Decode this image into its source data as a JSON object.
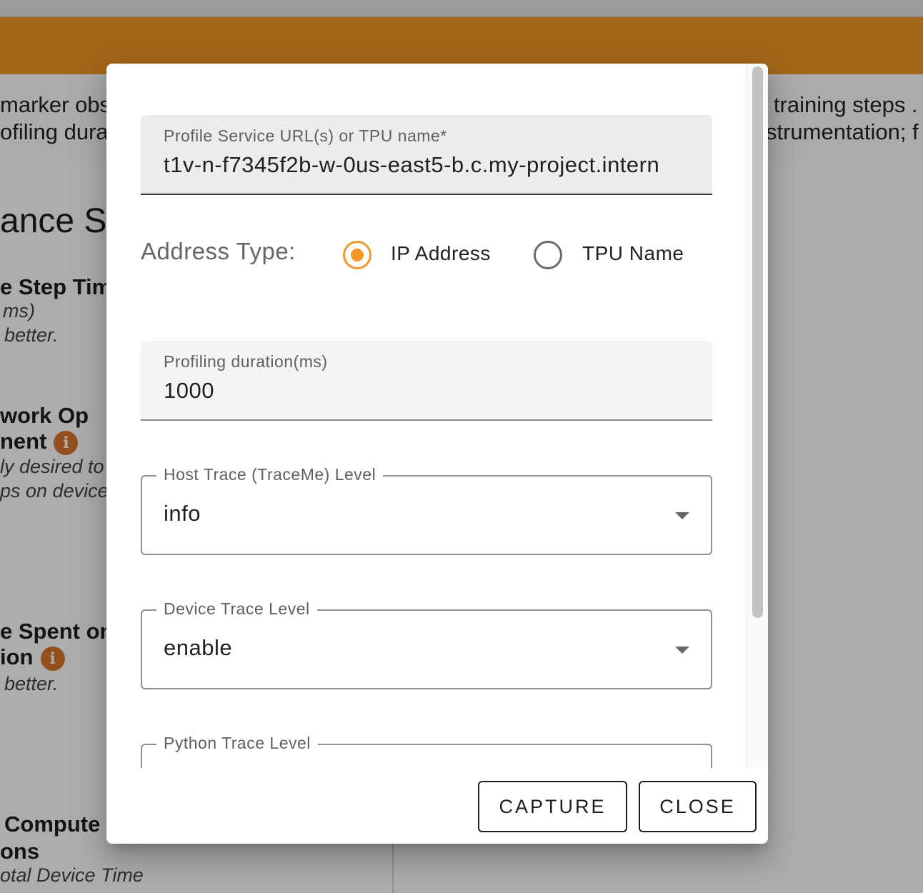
{
  "background": {
    "banner_line1_left": "marker obs",
    "banner_line2_left": "ofiling dura",
    "banner_line1_right": ") training steps .",
    "banner_line2_right": "strumentation; f",
    "section_title": "ance S",
    "card1_title": "e Step Tim",
    "card1_unit": "ms)",
    "card1_hint": "better.",
    "card2_title_line1": "work Op",
    "card2_title_line2": "nent",
    "card2_hint_line1": "ly desired to",
    "card2_hint_line2": "ps on device",
    "card3_title_line1": "e Spent on",
    "card3_title_line2": "ion",
    "card3_hint": "better.",
    "card4_title_line1": "Compute",
    "card4_title_line2": "ons",
    "card4_hint": "otal Device Time",
    "info_glyph": "i"
  },
  "dialog": {
    "service_url": {
      "label": "Profile Service URL(s) or TPU name*",
      "value": "t1v-n-f7345f2b-w-0us-east5-b.c.my-project.intern"
    },
    "address_type": {
      "label": "Address Type:",
      "options": [
        {
          "label": "IP Address",
          "selected": true
        },
        {
          "label": "TPU Name",
          "selected": false
        }
      ]
    },
    "duration": {
      "label": "Profiling duration(ms)",
      "value": "1000"
    },
    "host_trace": {
      "label": "Host Trace (TraceMe) Level",
      "value": "info"
    },
    "device_trace": {
      "label": "Device Trace Level",
      "value": "enable"
    },
    "python_trace": {
      "label": "Python Trace Level",
      "value": ""
    },
    "actions": {
      "capture_label": "CAPTURE",
      "close_label": "CLOSE"
    }
  },
  "colors": {
    "accent": "#f29727",
    "info_badge": "#d9772c",
    "field_bg": "#ececec"
  }
}
